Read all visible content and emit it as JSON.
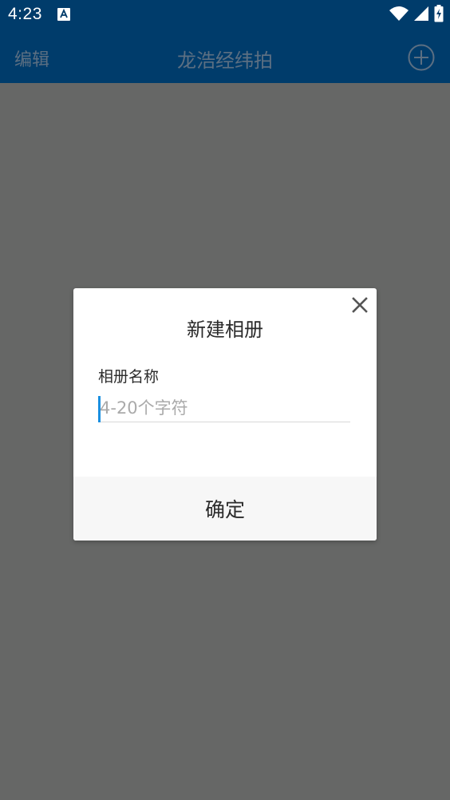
{
  "status_bar": {
    "time": "4:23",
    "icons": [
      "keyboard-notification-icon",
      "wifi-icon",
      "cell-signal-icon",
      "battery-charging-icon"
    ]
  },
  "app_bar": {
    "edit_label": "编辑",
    "title": "龙浩经纬拍",
    "add_icon": "plus-circle-icon"
  },
  "dialog": {
    "title": "新建相册",
    "close_icon": "close-icon",
    "field_label": "相册名称",
    "input_value": "",
    "input_placeholder": "4-20个字符",
    "confirm_label": "确定"
  },
  "colors": {
    "app_bar": "#003c6b",
    "scrim": "#666766",
    "accent_caret": "#1a8fe0",
    "dim_text": "#5c6f82"
  }
}
